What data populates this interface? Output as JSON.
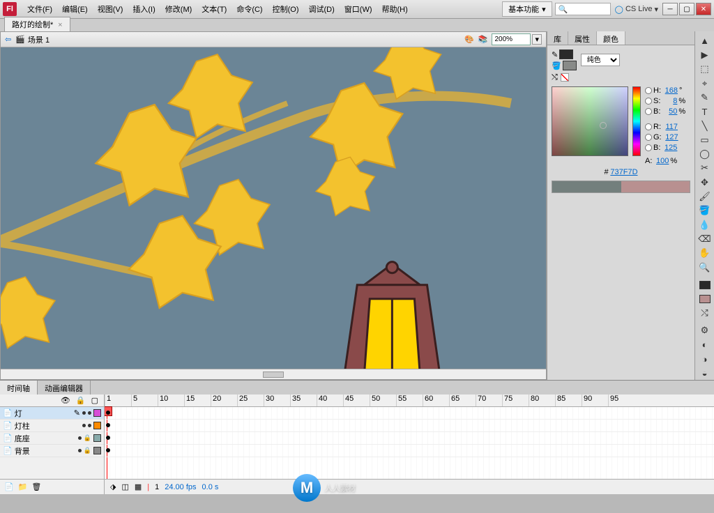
{
  "app": {
    "logo": "Fl"
  },
  "menu": [
    "文件(F)",
    "编辑(E)",
    "视图(V)",
    "插入(I)",
    "修改(M)",
    "文本(T)",
    "命令(C)",
    "控制(O)",
    "调试(D)",
    "窗口(W)",
    "帮助(H)"
  ],
  "workspace": "基本功能",
  "cslive": "CS Live",
  "search_placeholder": "",
  "doc_tab": "路灯的绘制*",
  "scene": {
    "label": "场景 1",
    "zoom": "200%"
  },
  "right_panel": {
    "tabs": [
      "库",
      "属性",
      "颜色"
    ],
    "active_tab": 2,
    "fill_type": "纯色",
    "hsb": {
      "H": "168",
      "S": "8",
      "B": "50"
    },
    "rgb": {
      "R": "117",
      "G": "127",
      "B": "125"
    },
    "alpha": "100",
    "hex": "737F7D",
    "deg": "°",
    "pct": "%",
    "labels": {
      "H": "H:",
      "S": "S:",
      "Bv": "B:",
      "R": "R:",
      "G": "G:",
      "B": "B:",
      "A": "A:",
      "hash": "#"
    },
    "stroke_swatch": "#2a2a2a",
    "fill_swatch": "#888a88"
  },
  "tools": [
    "▲",
    "▶",
    "⬚",
    "⌖",
    "✎",
    "T",
    "╲",
    "▭",
    "◯",
    "✂",
    "✥",
    "🖌",
    "🪣",
    "🔍",
    "◧",
    "◨",
    "⚙",
    "◐",
    "◑",
    "◒"
  ],
  "bottom": {
    "tabs": [
      "时间轴",
      "动画编辑器"
    ],
    "active": 0,
    "ruler": [
      "1",
      "5",
      "10",
      "15",
      "20",
      "25",
      "30",
      "35",
      "40",
      "45",
      "50",
      "55",
      "60",
      "65",
      "70",
      "75",
      "80",
      "85",
      "90",
      "95"
    ],
    "layers": [
      {
        "name": "灯",
        "color": "#d74fd7",
        "active": true,
        "edit": true
      },
      {
        "name": "灯柱",
        "color": "#ff8a00",
        "active": false
      },
      {
        "name": "底座",
        "color": "#8aa",
        "active": false,
        "locked": true
      },
      {
        "name": "背景",
        "color": "#888",
        "active": false,
        "locked": true
      }
    ],
    "footer": {
      "frame": "1",
      "fps": "24.00 fps",
      "time": "0.0 s"
    }
  },
  "watermark": "人人素材"
}
